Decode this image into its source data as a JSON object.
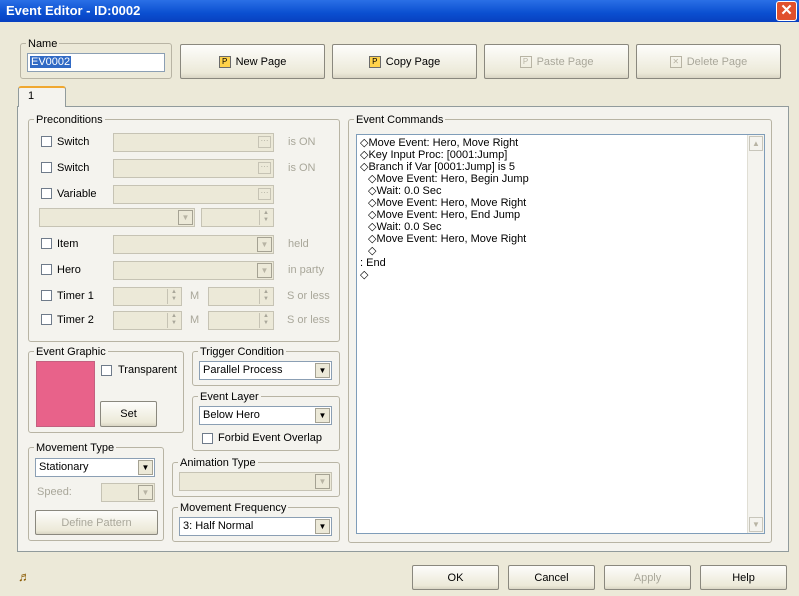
{
  "window": {
    "title": "Event Editor - ID:0002"
  },
  "name_group": {
    "legend": "Name",
    "value": "EV0002"
  },
  "page_buttons": {
    "new_page": "New Page",
    "copy_page": "Copy Page",
    "paste_page": "Paste Page",
    "delete_page": "Delete Page"
  },
  "tabs": [
    {
      "label": "1"
    }
  ],
  "preconditions": {
    "legend": "Preconditions",
    "switch1": {
      "label": "Switch",
      "suffix": "is ON"
    },
    "switch2": {
      "label": "Switch",
      "suffix": "is ON"
    },
    "variable": {
      "label": "Variable"
    },
    "item": {
      "label": "Item",
      "suffix": "held"
    },
    "hero": {
      "label": "Hero",
      "suffix": "in party"
    },
    "timer1": {
      "label": "Timer 1",
      "m": "M",
      "suffix": "S or less"
    },
    "timer2": {
      "label": "Timer 2",
      "m": "M",
      "suffix": "S or less"
    }
  },
  "event_graphic": {
    "legend": "Event Graphic",
    "transparent_label": "Transparent",
    "set_label": "Set",
    "color": "#e8628a"
  },
  "trigger": {
    "legend": "Trigger Condition",
    "value": "Parallel Process"
  },
  "event_layer": {
    "legend": "Event Layer",
    "value": "Below Hero",
    "forbid_label": "Forbid Event Overlap"
  },
  "movement_type": {
    "legend": "Movement Type",
    "value": "Stationary",
    "speed_label": "Speed:",
    "define_pattern": "Define Pattern"
  },
  "animation_type": {
    "legend": "Animation Type",
    "value": ""
  },
  "movement_frequency": {
    "legend": "Movement Frequency",
    "value": "3: Half Normal"
  },
  "event_commands": {
    "legend": "Event Commands",
    "lines": [
      "◇Move Event: Hero, Move Right",
      "◇Key Input Proc: [0001:Jump]",
      "◇Branch if Var [0001:Jump] is 5",
      "  ◇Move Event: Hero, Begin Jump",
      "  ◇Wait: 0.0 Sec",
      "  ◇Move Event: Hero, Move Right",
      "  ◇Move Event: Hero, End Jump",
      "  ◇Wait: 0.0 Sec",
      "  ◇Move Event: Hero, Move Right",
      "  ◇",
      ": End",
      "◇"
    ]
  },
  "footer": {
    "ok": "OK",
    "cancel": "Cancel",
    "apply": "Apply",
    "help": "Help"
  },
  "icons": {
    "close": "close-icon",
    "music": "music-note-icon"
  }
}
